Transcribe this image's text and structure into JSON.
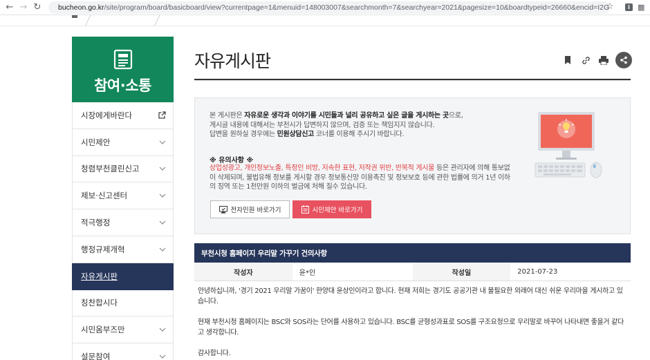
{
  "browser": {
    "url_host": "bucheon.go.kr",
    "url_path": "/site/program/board/basicboard/view?currentpage=1&menuid=148003007&searchmonth=7&searchyear=2021&pagesize=10&boardtypeid=26660&encid=I2GZM4Z..."
  },
  "sidebar": {
    "title": "참여·소통",
    "items": [
      {
        "label": "시장에게바란다"
      },
      {
        "label": "시민제안"
      },
      {
        "label": "청렴부천클린신고"
      },
      {
        "label": "제보·신고센터"
      },
      {
        "label": "적극행정"
      },
      {
        "label": "행정규제개혁"
      },
      {
        "label": "자유게시판"
      },
      {
        "label": "칭찬합시다"
      },
      {
        "label": "시민옴부즈만"
      },
      {
        "label": "설문참여"
      }
    ]
  },
  "page": {
    "title": "자유게시판"
  },
  "notice": {
    "line1_prefix": "본 게시판은 ",
    "line1_bold": "자유로운 생각과 이야기를 시민들과 널리 공유하고 싶은 글을 게시하는 곳",
    "line1_suffix": "으로,",
    "line2": "게시글 내용에 대해서는 부천시가 답변하지 않으며, 검증 또는 책임지지 않습니다.",
    "line3_prefix": "답변을 원하실 경우에는 ",
    "line3_bold": "민원상담신고",
    "line3_suffix": " 코너를 이용해 주시기 바랍니다.",
    "warning_title": "※ 유의사항 ※",
    "warning_red": "상업성광고, 개인정보노출, 특정인 비방, 저속한 표현, 저작권 위반, 반복적 게시물",
    "warning_rest": " 등은 관리자에 의해 통보없이 삭제되며, 불법유해 정보를 게시할 경우 정보통신망 이용촉진 및 정보보호 등에 관한 법률에 의거 1년 이하의 징역 또는 1천만원 이하의 벌금에 처해 질수 있습니다.",
    "btn_minwon": "전자민원 바로가기",
    "btn_proposal": "시민제안 바로가기"
  },
  "post": {
    "title": "부천시청 홈페이지 우리말 가꾸기 건의사항",
    "author_label": "작성자",
    "author": "윤*인",
    "date_label": "작성일",
    "date": "2021-07-23",
    "body": [
      "안녕하십니까, '경기 2021 우리말 가꿈이' 한양대 윤상인이라고 합니다. 현재 저희는 경기도 공공기관 내 불필요한 외래어 대신 쉬운 우리마을 게시하고 있습니다.",
      "현재 부천시청 홈페이지는 BSC와 SOS라는 단어를 사용하고 있습니다. BSC를 균형성과표로 SOS를 구조요청으로 우리말로 바꾸어 나타내면 좋을거 같다고 생각합니다.",
      "감사합니다."
    ]
  },
  "colors": {
    "sidebar_head": "#12875b",
    "active_nav": "#26355a",
    "proposal_button": "#e8515f",
    "warning_red": "#e04040"
  }
}
